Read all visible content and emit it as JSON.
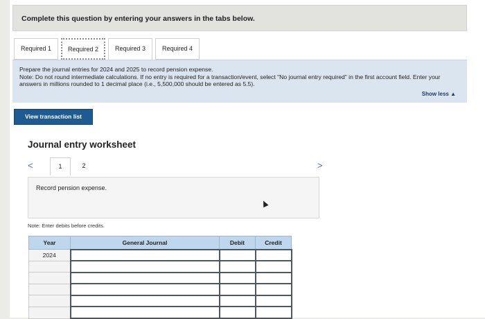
{
  "banner": {
    "text": "Complete this question by entering your answers in the tabs below."
  },
  "tabs": [
    {
      "label": "Required 1"
    },
    {
      "label": "Required 2"
    },
    {
      "label": "Required 3"
    },
    {
      "label": "Required 4"
    }
  ],
  "instructions": {
    "line1": "Prepare the journal entries for 2024 and 2025 to record pension expense.",
    "line2": "Note: Do not round intermediate calculations. If no entry is required for a transaction/event, select \"No journal entry required\" in the first account field. Enter your answers in millions rounded to 1 decimal place (i.e., 5,500,000 should be entered as 5.5).",
    "show_less": "Show less ▲"
  },
  "view_button": "View transaction list",
  "worksheet": {
    "title": "Journal entry worksheet",
    "prev": "<",
    "next": ">",
    "pages": [
      "1",
      "2"
    ],
    "entry_text": "Record pension expense.",
    "note": "Note: Enter debits before credits."
  },
  "table": {
    "headers": {
      "year": "Year",
      "journal": "General Journal",
      "debit": "Debit",
      "credit": "Credit"
    },
    "rows": [
      {
        "year": "2024"
      },
      {
        "year": ""
      },
      {
        "year": ""
      },
      {
        "year": ""
      },
      {
        "year": ""
      },
      {
        "year": ""
      }
    ]
  }
}
